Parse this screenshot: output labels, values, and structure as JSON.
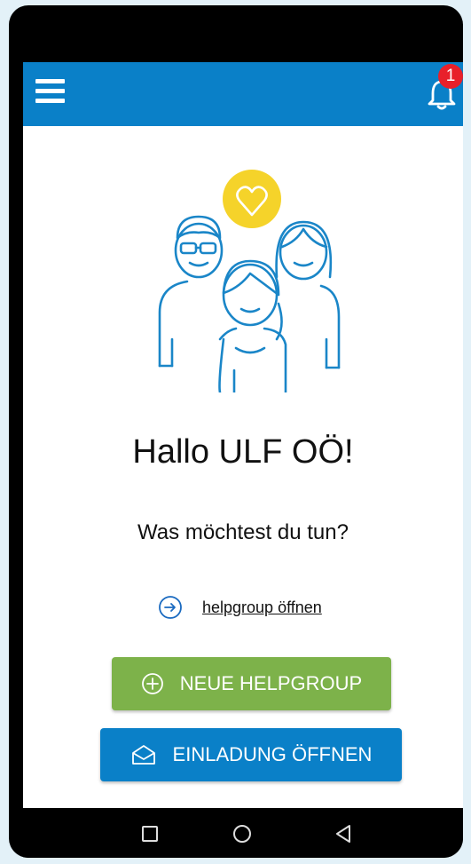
{
  "header": {
    "menu_icon": "hamburger-icon",
    "notification_icon": "bell-icon",
    "notification_count": "1"
  },
  "main": {
    "greeting": "Hallo ULF OÖ!",
    "question": "Was möchtest du tun?",
    "open_link": {
      "label": "helpgroup öffnen",
      "icon": "arrow-circle-right-icon"
    },
    "new_button": {
      "label": "NEUE HELPGROUP",
      "icon": "plus-circle-icon"
    },
    "invite_button": {
      "label": "EINLADUNG ÖFFNEN",
      "icon": "envelope-open-icon"
    }
  },
  "nav": {
    "items": [
      "recent-apps-icon",
      "home-icon",
      "back-icon"
    ]
  },
  "colors": {
    "primary_blue": "#0a80c8",
    "green": "#7db24a",
    "badge_red": "#e8202a",
    "heart_yellow": "#f5d32a",
    "background": "#e3f1f8"
  }
}
